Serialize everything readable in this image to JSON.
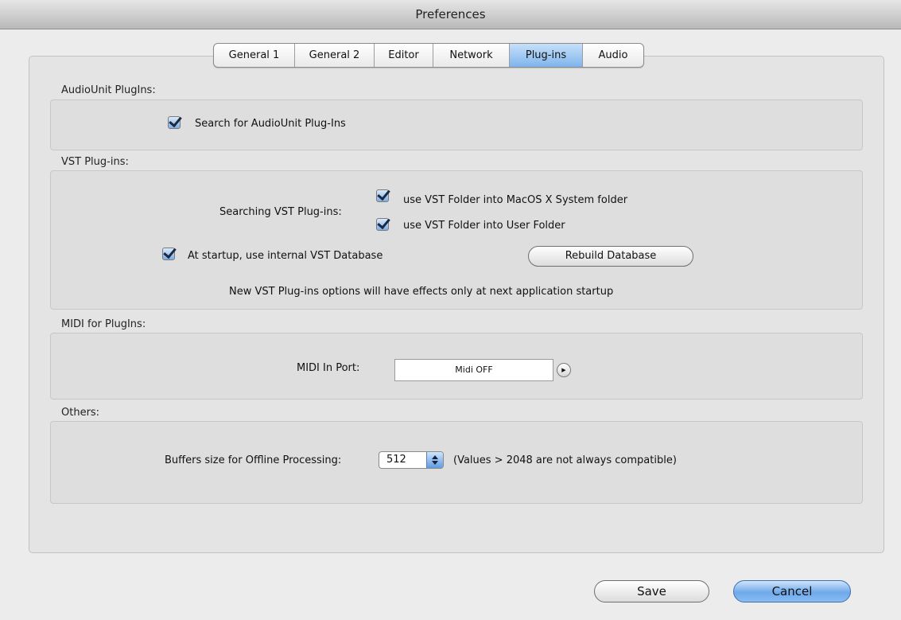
{
  "window": {
    "title": "Preferences"
  },
  "tabs": [
    {
      "label": "General 1",
      "active": false
    },
    {
      "label": "General 2",
      "active": false
    },
    {
      "label": "Editor",
      "active": false
    },
    {
      "label": "Network",
      "active": false
    },
    {
      "label": "Plug-ins",
      "active": true
    },
    {
      "label": "Audio",
      "active": false
    }
  ],
  "audiounit": {
    "heading": "AudioUnit PlugIns:",
    "search_label": "Search for AudioUnit Plug-Ins",
    "search_checked": true
  },
  "vst": {
    "heading": "VST Plug-ins:",
    "searching_label": "Searching VST Plug-ins:",
    "system_folder_label": "use VST Folder into MacOS X System folder",
    "system_folder_checked": true,
    "user_folder_label": "use VST Folder into User Folder",
    "user_folder_checked": true,
    "startup_db_label": "At startup, use internal VST Database",
    "startup_db_checked": true,
    "rebuild_label": "Rebuild Database",
    "note": "New VST Plug-ins options will have effects only at next application startup"
  },
  "midi": {
    "heading": "MIDI for PlugIns:",
    "port_label": "MIDI In Port:",
    "port_value": "Midi OFF"
  },
  "others": {
    "heading": "Others:",
    "buffer_label": "Buffers size for Offline Processing:",
    "buffer_value": "512",
    "buffer_note": "(Values > 2048 are not always compatible)"
  },
  "buttons": {
    "save": "Save",
    "cancel": "Cancel"
  },
  "colors": {
    "accent": "#7fb4ec",
    "window_bg": "#ececec"
  },
  "icons": [
    "checkbox-checked-icon",
    "disclosure-arrow-icon",
    "stepper-arrows-icon"
  ]
}
